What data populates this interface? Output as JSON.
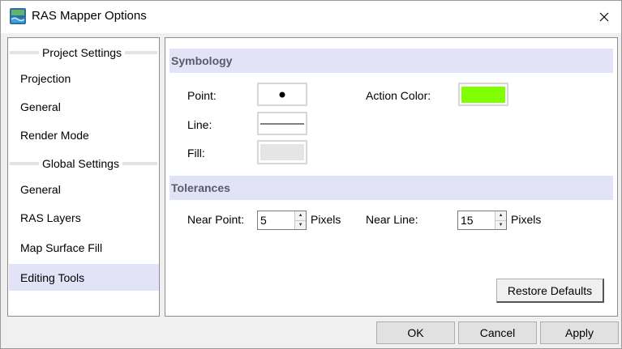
{
  "window": {
    "title": "RAS Mapper Options",
    "close_glyph": "✕",
    "icon": "ras-mapper-app-icon"
  },
  "nav": {
    "project_section": "Project Settings",
    "project_items": [
      {
        "label": "Projection"
      },
      {
        "label": "General"
      },
      {
        "label": "Render Mode"
      }
    ],
    "global_section": "Global Settings",
    "global_items": [
      {
        "label": "General"
      },
      {
        "label": "RAS Layers"
      },
      {
        "label": "Map Surface Fill"
      },
      {
        "label": "Editing Tools",
        "selected": true
      }
    ]
  },
  "symbology": {
    "header": "Symbology",
    "point_label": "Point:",
    "line_label": "Line:",
    "fill_label": "Fill:",
    "action_color_label": "Action Color:",
    "action_color": "#80ff00",
    "fill_color": "#e5e5e5",
    "line_color": "#808080"
  },
  "tolerances": {
    "header": "Tolerances",
    "near_point_label": "Near Point:",
    "near_point_value": "5",
    "near_point_unit": "Pixels",
    "near_line_label": "Near Line:",
    "near_line_value": "15",
    "near_line_unit": "Pixels"
  },
  "buttons": {
    "restore_defaults": "Restore Defaults",
    "ok": "OK",
    "cancel": "Cancel",
    "apply": "Apply"
  },
  "colors": {
    "header_bg": "#e3e3f7",
    "selected_bg": "#e3e3f7"
  }
}
